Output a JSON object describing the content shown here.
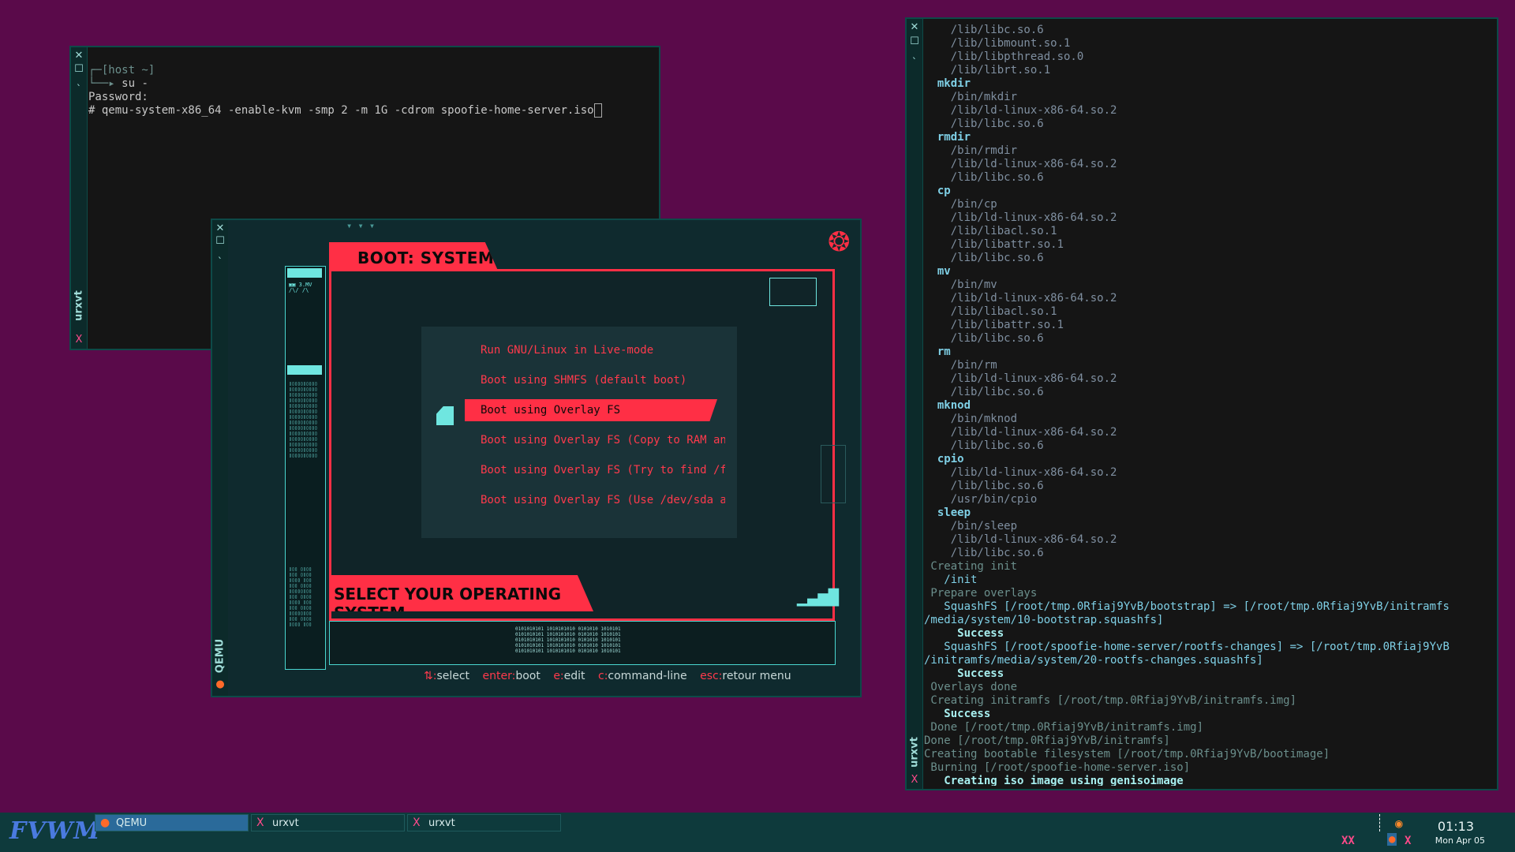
{
  "colors": {
    "desktop": "#5a0a4a",
    "accent_red": "#ff2f45",
    "accent_cyan": "#6fe6e0",
    "taskbar": "#0e3a3c"
  },
  "term1": {
    "title": "urxvt",
    "prompt_host": "[host ~]",
    "cmd_su": "su -",
    "password": "Password:",
    "cmd_qemu": "# qemu-system-x86_64 -enable-kvm -smp 2 -m 1G -cdrom spoofie-home-server.iso"
  },
  "qemu": {
    "title": "QEMU",
    "boot_title": "BOOT: SYSTEM",
    "select_title": "SELECT YOUR OPERATING SYSTEM",
    "menu": [
      "Run GNU/Linux in Live-mode",
      "Boot using SHMFS (default boot)",
      "Boot using Overlay FS",
      "Boot using Overlay FS (Copy to RAM anc",
      "Boot using Overlay FS (Try to find /fi",
      "Boot using Overlay FS (Use /dev/sda as"
    ],
    "keys": [
      {
        "key": "⇅:",
        "desc": "select"
      },
      {
        "key": "enter:",
        "desc": "boot"
      },
      {
        "key": "e:",
        "desc": "edit"
      },
      {
        "key": "c:",
        "desc": "command-line"
      },
      {
        "key": "esc:",
        "desc": "retour menu"
      }
    ]
  },
  "term2": {
    "title": "urxvt",
    "lines": [
      {
        "c": "t-path",
        "t": "    /lib/libc.so.6"
      },
      {
        "c": "t-path",
        "t": "    /lib/libmount.so.1"
      },
      {
        "c": "t-path",
        "t": "    /lib/libpthread.so.0"
      },
      {
        "c": "t-path",
        "t": "    /lib/librt.so.1"
      },
      {
        "c": "t-hdr",
        "t": "  mkdir"
      },
      {
        "c": "t-path",
        "t": "    /bin/mkdir"
      },
      {
        "c": "t-path",
        "t": "    /lib/ld-linux-x86-64.so.2"
      },
      {
        "c": "t-path",
        "t": "    /lib/libc.so.6"
      },
      {
        "c": "t-hdr",
        "t": "  rmdir"
      },
      {
        "c": "t-path",
        "t": "    /bin/rmdir"
      },
      {
        "c": "t-path",
        "t": "    /lib/ld-linux-x86-64.so.2"
      },
      {
        "c": "t-path",
        "t": "    /lib/libc.so.6"
      },
      {
        "c": "t-hdr",
        "t": "  cp"
      },
      {
        "c": "t-path",
        "t": "    /bin/cp"
      },
      {
        "c": "t-path",
        "t": "    /lib/ld-linux-x86-64.so.2"
      },
      {
        "c": "t-path",
        "t": "    /lib/libacl.so.1"
      },
      {
        "c": "t-path",
        "t": "    /lib/libattr.so.1"
      },
      {
        "c": "t-path",
        "t": "    /lib/libc.so.6"
      },
      {
        "c": "t-hdr",
        "t": "  mv"
      },
      {
        "c": "t-path",
        "t": "    /bin/mv"
      },
      {
        "c": "t-path",
        "t": "    /lib/ld-linux-x86-64.so.2"
      },
      {
        "c": "t-path",
        "t": "    /lib/libacl.so.1"
      },
      {
        "c": "t-path",
        "t": "    /lib/libattr.so.1"
      },
      {
        "c": "t-path",
        "t": "    /lib/libc.so.6"
      },
      {
        "c": "t-hdr",
        "t": "  rm"
      },
      {
        "c": "t-path",
        "t": "    /bin/rm"
      },
      {
        "c": "t-path",
        "t": "    /lib/ld-linux-x86-64.so.2"
      },
      {
        "c": "t-path",
        "t": "    /lib/libc.so.6"
      },
      {
        "c": "t-hdr",
        "t": "  mknod"
      },
      {
        "c": "t-path",
        "t": "    /bin/mknod"
      },
      {
        "c": "t-path",
        "t": "    /lib/ld-linux-x86-64.so.2"
      },
      {
        "c": "t-path",
        "t": "    /lib/libc.so.6"
      },
      {
        "c": "t-hdr",
        "t": "  cpio"
      },
      {
        "c": "t-path",
        "t": "    /lib/ld-linux-x86-64.so.2"
      },
      {
        "c": "t-path",
        "t": "    /lib/libc.so.6"
      },
      {
        "c": "t-path",
        "t": "    /usr/bin/cpio"
      },
      {
        "c": "t-hdr",
        "t": "  sleep"
      },
      {
        "c": "t-path",
        "t": "    /bin/sleep"
      },
      {
        "c": "t-path",
        "t": "    /lib/ld-linux-x86-64.so.2"
      },
      {
        "c": "t-path",
        "t": "    /lib/libc.so.6"
      },
      {
        "c": "t-dim",
        "t": " Creating init"
      },
      {
        "c": "t-cyan",
        "t": "   /init"
      },
      {
        "c": "t-dim",
        "t": " Prepare overlays"
      },
      {
        "c": "t-cyan",
        "t": "   SquashFS [/root/tmp.0Rfiaj9YvB/bootstrap] => [/root/tmp.0Rfiaj9YvB/initramfs"
      },
      {
        "c": "t-cyan",
        "t": "/media/system/10-bootstrap.squashfs]"
      },
      {
        "c": "t-bright",
        "t": "     Success"
      },
      {
        "c": "t-cyan",
        "t": "   SquashFS [/root/spoofie-home-server/rootfs-changes] => [/root/tmp.0Rfiaj9YvB"
      },
      {
        "c": "t-cyan",
        "t": "/initramfs/media/system/20-rootfs-changes.squashfs]"
      },
      {
        "c": "t-bright",
        "t": "     Success"
      },
      {
        "c": "t-dim",
        "t": " Overlays done"
      },
      {
        "c": "t-dim",
        "t": " Creating initramfs [/root/tmp.0Rfiaj9YvB/initramfs.img]"
      },
      {
        "c": "t-bright",
        "t": "   Success"
      },
      {
        "c": "t-dim",
        "t": " Done [/root/tmp.0Rfiaj9YvB/initramfs.img]"
      },
      {
        "c": "t-dim",
        "t": "Done [/root/tmp.0Rfiaj9YvB/initramfs]"
      },
      {
        "c": "t-dim",
        "t": "Creating bootable filesystem [/root/tmp.0Rfiaj9YvB/bootimage]"
      },
      {
        "c": "t-dim",
        "t": " Burning [/root/spoofie-home-server.iso]"
      },
      {
        "c": "t-bright",
        "t": "   Creating iso image using genisoimage"
      }
    ]
  },
  "taskbar": {
    "logo": "FVWM",
    "tasks": [
      {
        "label": "QEMU",
        "icon": "qemu-icon"
      },
      {
        "label": "urxvt",
        "icon": "x-icon"
      },
      {
        "label": "urxvt",
        "icon": "x-icon"
      }
    ],
    "time": "01:13",
    "date": "Mon Apr 05"
  }
}
